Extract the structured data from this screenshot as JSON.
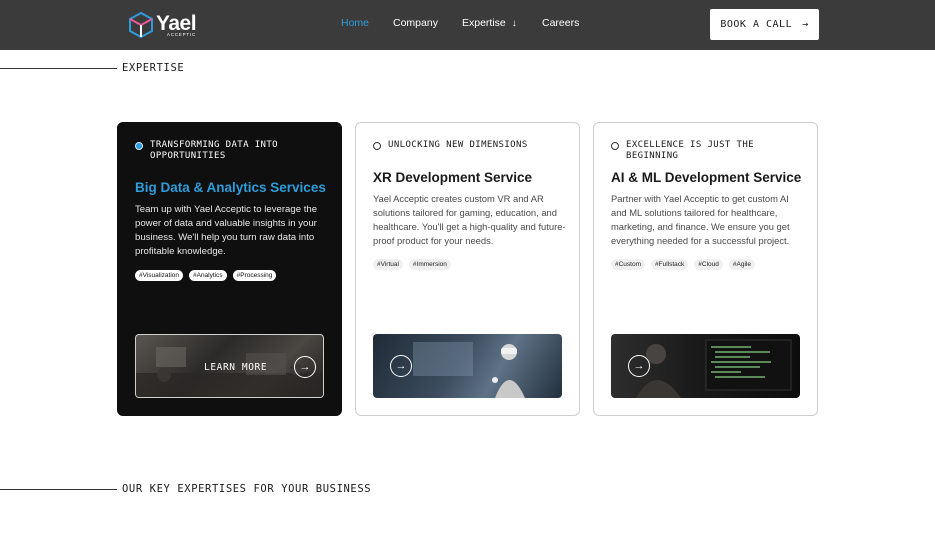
{
  "header": {
    "logo_name": "Yael",
    "logo_sub": "ACCEPTIC",
    "nav": [
      {
        "label": "Home",
        "active": true
      },
      {
        "label": "Company"
      },
      {
        "label": "Expertise",
        "icon": "arrow-down-icon"
      },
      {
        "label": "Careers"
      }
    ],
    "cta_label": "BOOK A CALL",
    "cta_icon": "arrow-right-icon"
  },
  "sections": {
    "expertise_label": "EXPERTISE",
    "key_label": "OUR KEY EXPERTISES FOR YOUR BUSINESS"
  },
  "cards": [
    {
      "eyebrow": "TRANSFORMING DATA INTO OPPORTUNITIES",
      "title": "Big Data & Analytics Services",
      "description": "Team up with Yael Acceptic to leverage the power of data and valuable insights in your business. We'll help you turn raw data into profitable knowledge.",
      "tags": [
        "#Visualization",
        "#Analytics",
        "#Processing"
      ],
      "cta": "LEARN MORE"
    },
    {
      "eyebrow": "UNLOCKING NEW DIMENSIONS",
      "title": "XR Development Service",
      "description": "Yael Acceptic creates custom VR and AR solutions tailored for gaming, education, and healthcare. You'll get a high-quality and future-proof product for your needs.",
      "tags": [
        "#Virtual",
        "#Immersion"
      ]
    },
    {
      "eyebrow": "EXCELLENCE IS JUST THE BEGINNING",
      "title": "AI & ML Development Service",
      "description": "Partner with Yael Acceptic to get custom AI and ML solutions tailored for healthcare, marketing, and finance. We ensure you get everything needed for a successful project.",
      "tags": [
        "#Custom",
        "#Fullstack",
        "#Cloud",
        "#Agile"
      ]
    }
  ],
  "colors": {
    "header_bg": "#3b3b3b",
    "accent": "#2d9cdb",
    "dark_card": "#0f0f0f"
  }
}
